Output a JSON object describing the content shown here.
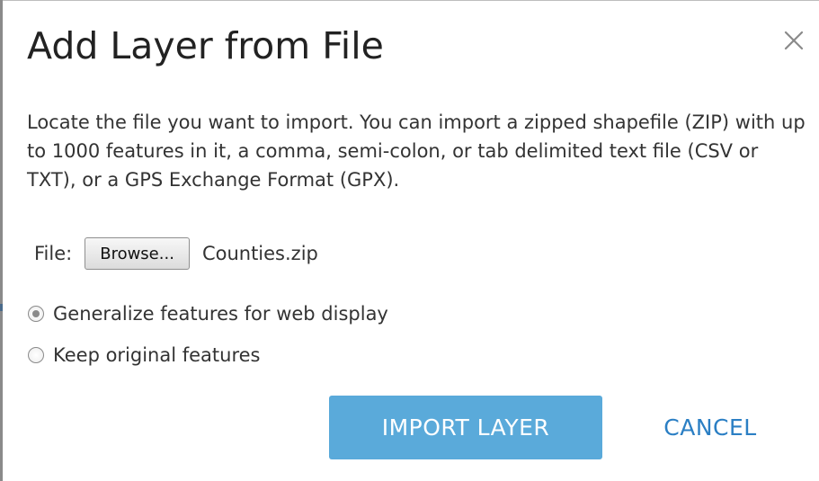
{
  "dialog": {
    "title": "Add Layer from File",
    "close_icon": "close-icon",
    "description": "Locate the file you want to import. You can import a zipped shapefile (ZIP) with up to 1000 features in it, a comma, semi-colon, or tab delimited text file (CSV or TXT), or a GPS Exchange Format (GPX)."
  },
  "file": {
    "label": "File:",
    "browse_label": "Browse...",
    "file_name": "Counties.zip"
  },
  "options": [
    {
      "label": "Generalize features for web display",
      "selected": true
    },
    {
      "label": "Keep original features",
      "selected": false
    }
  ],
  "actions": {
    "import_label": "IMPORT LAYER",
    "cancel_label": "CANCEL"
  },
  "colors": {
    "primary_button": "#5aaada",
    "link_button": "#2b7fc4",
    "text": "#333333"
  }
}
